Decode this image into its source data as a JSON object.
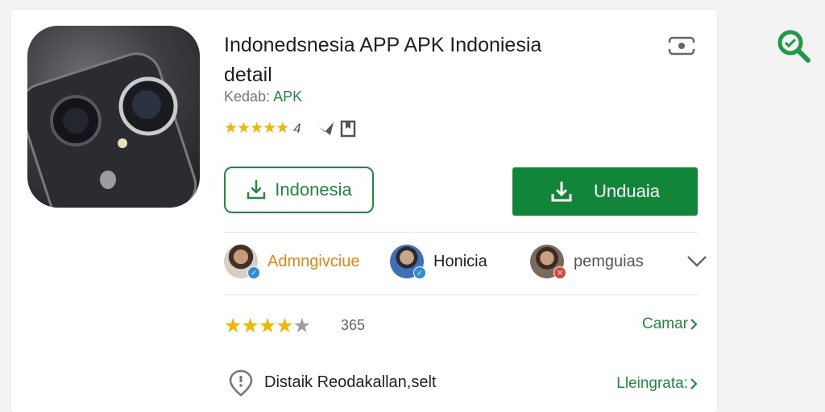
{
  "app": {
    "title_line1": "Indonedsnesia APP APK Indoniesia",
    "title_line2": "detail",
    "subtitle_prefix": "Kedab:",
    "subtitle_type": "APK",
    "rating_value": "4"
  },
  "buttons": {
    "outline_label": "Indonesia",
    "primary_label": "Unduaia"
  },
  "developers": [
    {
      "name": "Admngivciue",
      "color": "#e8830c",
      "badge_color": "#2a8fd6",
      "badge": "✓"
    },
    {
      "name": "Honicia",
      "color": "#202124",
      "badge_color": "#2a8fd6",
      "badge": "✓"
    },
    {
      "name": "pemguias",
      "color": "#555555",
      "badge_color": "#e0463c",
      "badge": "✕"
    }
  ],
  "reviews": {
    "count": "365",
    "link_label": "Camar"
  },
  "info": {
    "text": "Distaik Reodakallan,selt",
    "link_label": "Lleingrata:"
  },
  "icons": {
    "header_action": "screenshot-icon",
    "search": "search-icon",
    "info": "location-pin-icon"
  },
  "colors": {
    "accent": "#128638",
    "star": "#f4b400"
  }
}
